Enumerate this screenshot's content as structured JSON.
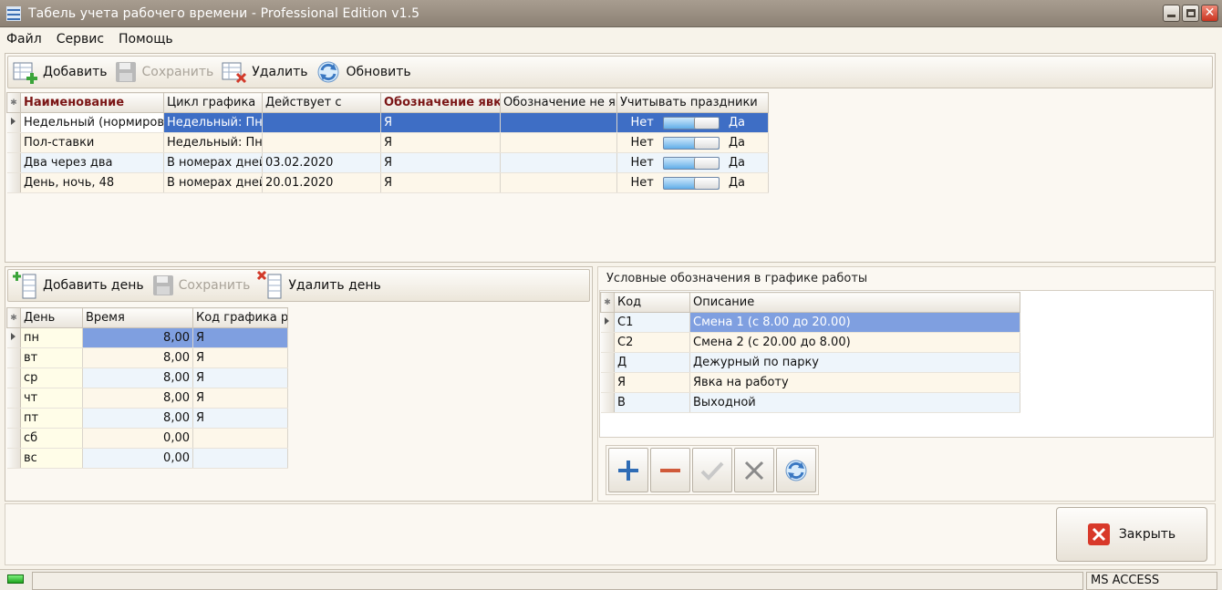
{
  "window": {
    "title": "Табель учета рабочего времени - Professional Edition v1.5"
  },
  "menu": [
    "Файл",
    "Сервис",
    "Помощь"
  ],
  "toolbar_top": {
    "add": "Добавить",
    "save": "Сохранить",
    "delete": "Удалить",
    "refresh": "Обновить"
  },
  "schedules": {
    "columns": [
      "Наименование",
      "Цикл графика",
      "Действует с",
      "Обозначение явк",
      "Обозначение не яв",
      "Учитывать праздники"
    ],
    "rows": [
      {
        "name": "Недельный (нормирова",
        "cycle": "Недельный:  Пн",
        "from": "",
        "yes_mark": "Я",
        "no_mark": "",
        "off": "Нет",
        "on": "Да"
      },
      {
        "name": "Пол-ставки",
        "cycle": "Недельный:  Пн",
        "from": "",
        "yes_mark": "Я",
        "no_mark": "",
        "off": "Нет",
        "on": "Да"
      },
      {
        "name": "Два через два",
        "cycle": "В номерах дней",
        "from": "03.02.2020",
        "yes_mark": "Я",
        "no_mark": "",
        "off": "Нет",
        "on": "Да"
      },
      {
        "name": "День, ночь, 48",
        "cycle": "В номерах дней",
        "from": "20.01.2020",
        "yes_mark": "Я",
        "no_mark": "",
        "off": "Нет",
        "on": "Да"
      }
    ]
  },
  "toolbar_days": {
    "add": "Добавить день",
    "save": "Сохранить",
    "delete": "Удалить день"
  },
  "days": {
    "columns": [
      "День",
      "Время",
      "Код графика ра"
    ],
    "rows": [
      {
        "day": "пн",
        "time": "8,00",
        "code": "Я"
      },
      {
        "day": "вт",
        "time": "8,00",
        "code": "Я"
      },
      {
        "day": "ср",
        "time": "8,00",
        "code": "Я"
      },
      {
        "day": "чт",
        "time": "8,00",
        "code": "Я"
      },
      {
        "day": "пт",
        "time": "8,00",
        "code": "Я"
      },
      {
        "day": "сб",
        "time": "0,00",
        "code": ""
      },
      {
        "day": "вс",
        "time": "0,00",
        "code": ""
      }
    ]
  },
  "legend": {
    "title": "Условные обозначения в графике работы",
    "columns": [
      "Код",
      "Описание"
    ],
    "rows": [
      {
        "code": "С1",
        "desc": "Смена 1 (с 8.00 до 20.00)"
      },
      {
        "code": "С2",
        "desc": "Смена 2 (с 20.00 до 8.00)"
      },
      {
        "code": "Д",
        "desc": "Дежурный по парку"
      },
      {
        "code": "Я",
        "desc": "Явка на работу"
      },
      {
        "code": "В",
        "desc": "Выходной"
      }
    ]
  },
  "close_button": "Закрыть",
  "status": {
    "db": "MS ACCESS"
  },
  "colors": {
    "selection": "#3e6ec5",
    "legend_selection": "#7f9fe0",
    "required_header": "#7b1616"
  }
}
